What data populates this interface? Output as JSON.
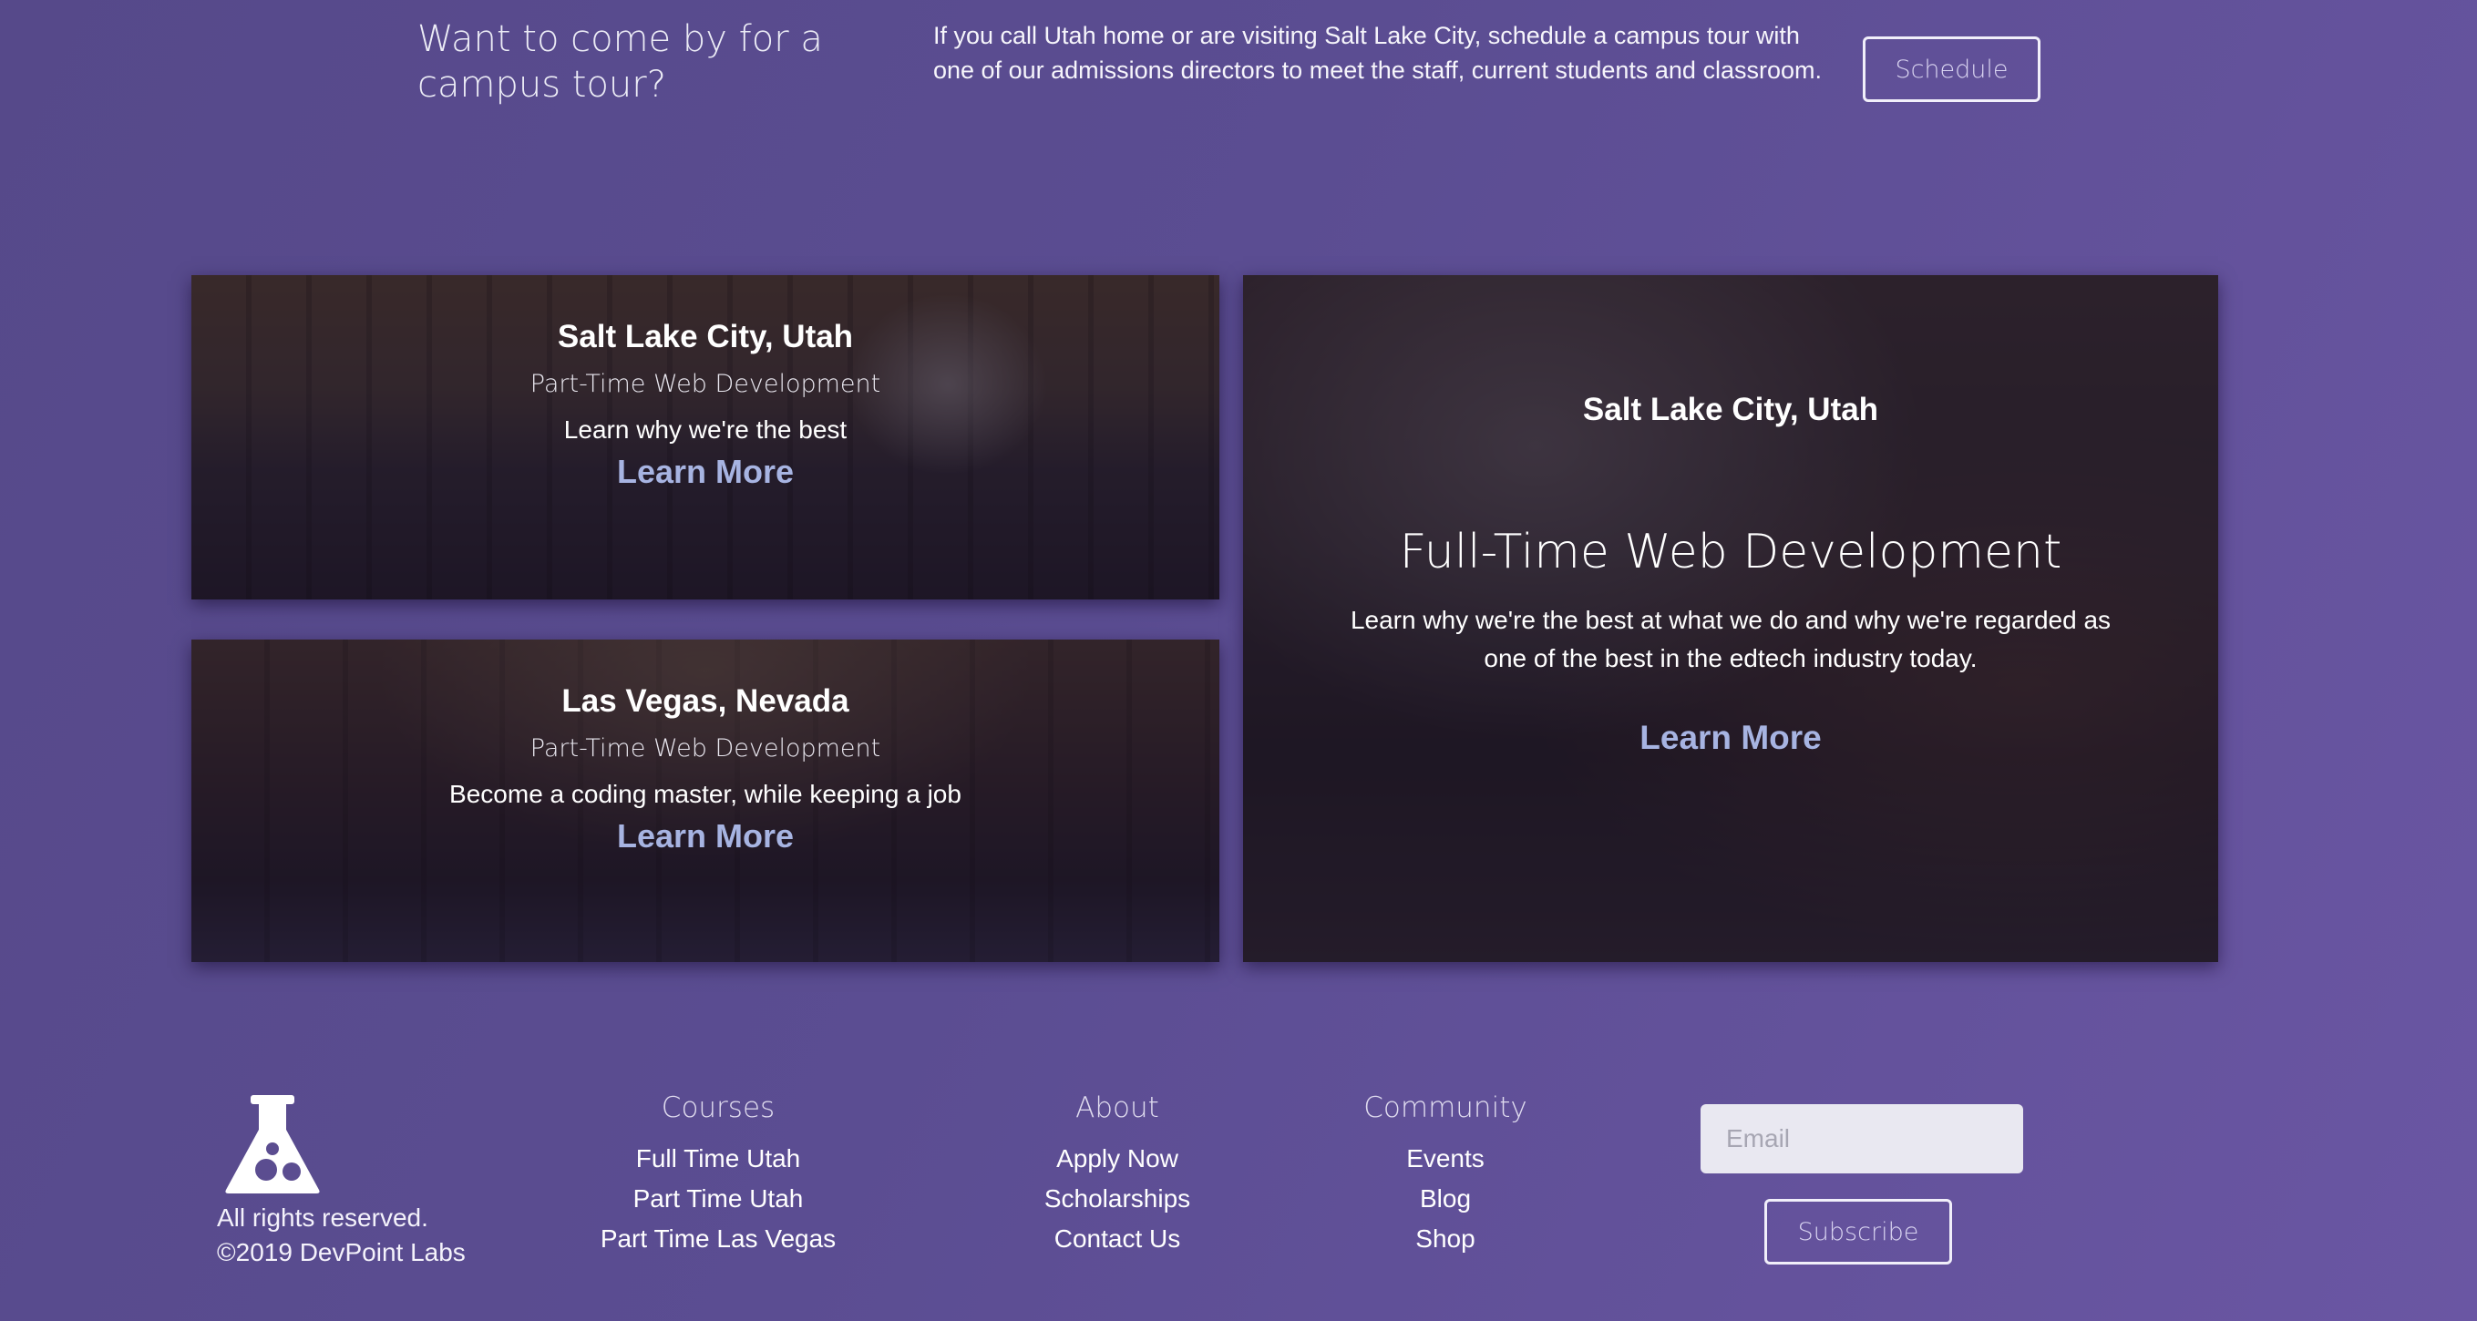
{
  "tour": {
    "heading": "Want to come by for a campus tour?",
    "text": "If you call Utah home or are visiting Salt Lake City, schedule a campus tour with one of our admissions directors to meet the staff, current students and classroom.",
    "button_label": "Schedule"
  },
  "cards": {
    "slc_part_time": {
      "city": "Salt Lake City, Utah",
      "program": "Part-Time Web Development",
      "tagline": "Learn why we're the best",
      "link_label": "Learn More"
    },
    "lv_part_time": {
      "city": "Las Vegas, Nevada",
      "program": "Part-Time Web Development",
      "tagline": "Become a coding master, while keeping a job",
      "link_label": "Learn More"
    },
    "slc_full_time": {
      "city": "Salt Lake City, Utah",
      "program": "Full-Time Web Development",
      "tagline": "Learn why we're the best at what we do and why we're regarded as one of the best in the edtech industry today.",
      "link_label": "Learn More"
    }
  },
  "footer": {
    "logo_icon": "flask-icon",
    "rights": "All rights reserved.",
    "copyright": "©2019 DevPoint Labs",
    "columns": [
      {
        "title": "Courses",
        "links": [
          "Full Time Utah",
          "Part Time Utah",
          "Part Time Las Vegas"
        ]
      },
      {
        "title": "About",
        "links": [
          "Apply Now",
          "Scholarships",
          "Contact Us"
        ]
      },
      {
        "title": "Community",
        "links": [
          "Events",
          "Blog",
          "Shop"
        ]
      }
    ],
    "email_placeholder": "Email",
    "subscribe_label": "Subscribe"
  },
  "colors": {
    "background_start": "#56498a",
    "background_end": "#6a56a3",
    "link_accent": "#a7b4e2",
    "button_border": "#f1effa"
  }
}
